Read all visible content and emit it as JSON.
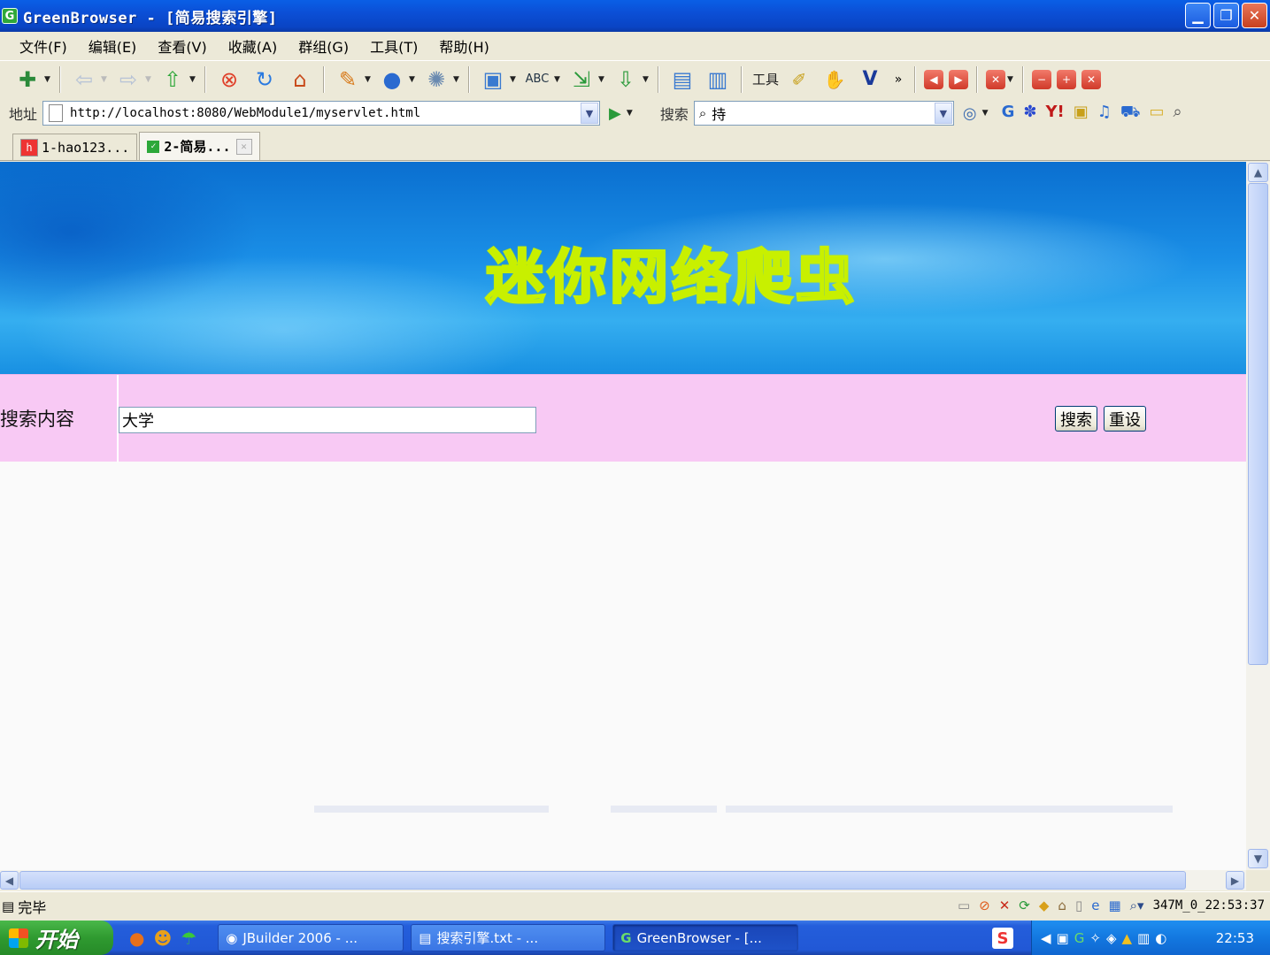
{
  "window": {
    "title": "GreenBrowser - [简易搜索引擎]",
    "app_icon": "G",
    "minimize": "▁",
    "maximize": "❐",
    "close": "✕"
  },
  "menu": [
    "文件(F)",
    "编辑(E)",
    "查看(V)",
    "收藏(A)",
    "群组(G)",
    "工具(T)",
    "帮助(H)"
  ],
  "toolbar": {
    "tools_label": "工具"
  },
  "address": {
    "label": "地址",
    "url": "http://localhost:8080/WebModule1/myservlet.html",
    "search_label": "搜索",
    "search_value": "持"
  },
  "tabs": [
    {
      "label": "1-hao123..."
    },
    {
      "label": "2-简易..."
    }
  ],
  "page": {
    "banner_title": "迷你网络爬虫",
    "row_label": "搜索内容",
    "query_value": "大学",
    "search_button": "搜索",
    "reset_button": "重设"
  },
  "status": {
    "text": "完毕",
    "clock": "347M_0_22:53:37"
  },
  "taskbar": {
    "start": "开始",
    "tasks": [
      {
        "label": "JBuilder 2006 - ..."
      },
      {
        "label": "搜索引擎.txt - ..."
      },
      {
        "label": "GreenBrowser - [..."
      }
    ],
    "sogou": "S",
    "time": "22:53"
  },
  "colors": {
    "titlebar": "#0b4fd6",
    "search_row": "#f8c9f4",
    "banner_text_outline": "#c8f000"
  }
}
